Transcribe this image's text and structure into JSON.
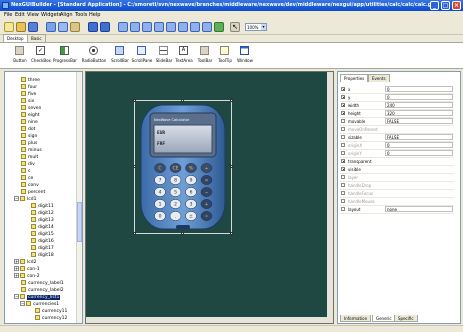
{
  "window": {
    "title": "NexGUIBuilder - [Standard Application] - C:/smoreti/svn/nexwave/branches/middleware/nexwave/dev/middleware/nexgui/app/utilities/calc/calc/calc.gui",
    "minimize": "_",
    "maximize": "□",
    "close": "×"
  },
  "menu": [
    "File",
    "Edit",
    "View",
    "Widgets",
    "Align",
    "Tools",
    "Help"
  ],
  "toolbar": {
    "zoom": "100%",
    "zoom_arrow": "▾"
  },
  "palette_tabs": [
    "Desktop",
    "Basic"
  ],
  "palette": [
    "Button",
    "CheckBox",
    "ProgressBar",
    "RadioButton",
    "ScrollBar",
    "ScrollPane",
    "SlideBar",
    "TextArea",
    "ToolBar",
    "ToolTip",
    "Window"
  ],
  "tree": [
    {
      "label": "three"
    },
    {
      "label": "four"
    },
    {
      "label": "five"
    },
    {
      "label": "six"
    },
    {
      "label": "seven"
    },
    {
      "label": "eight"
    },
    {
      "label": "nine"
    },
    {
      "label": "dot"
    },
    {
      "label": "sign"
    },
    {
      "label": "plus"
    },
    {
      "label": "minus"
    },
    {
      "label": "mult"
    },
    {
      "label": "div"
    },
    {
      "label": "c"
    },
    {
      "label": "ce"
    },
    {
      "label": "conv"
    },
    {
      "label": "percent"
    },
    {
      "label": "lcd1",
      "toggle": "−"
    },
    {
      "label": "digit11"
    },
    {
      "label": "digit12"
    },
    {
      "label": "digit13"
    },
    {
      "label": "digit14"
    },
    {
      "label": "digit15"
    },
    {
      "label": "digit16"
    },
    {
      "label": "digit17"
    },
    {
      "label": "digit18"
    },
    {
      "label": "lcd2",
      "toggle": "+"
    },
    {
      "label": "con-1",
      "toggle": "+"
    },
    {
      "label": "con-2",
      "toggle": "+"
    },
    {
      "label": "currency_label1"
    },
    {
      "label": "currency_label2"
    },
    {
      "label": "currency_list1",
      "toggle": "−",
      "selected": true
    },
    {
      "label": "currencies1",
      "toggle": "−"
    },
    {
      "label": "currency11"
    },
    {
      "label": "currency12"
    }
  ],
  "calculator": {
    "title": "NexWave Calculator",
    "lcd1": "EUR",
    "lcd2": "FRF",
    "keys": [
      [
        "C",
        "CE",
        "%",
        "÷"
      ],
      [
        "7",
        "8",
        "9",
        "×"
      ],
      [
        "4",
        "5",
        "6",
        "−"
      ],
      [
        "1",
        "2",
        "3",
        "+"
      ],
      [
        "0",
        ".",
        "±",
        "="
      ]
    ]
  },
  "props_tabs": [
    "Properties",
    "Events"
  ],
  "props": [
    {
      "name": "x",
      "value": "0",
      "checked": true,
      "enabled": true
    },
    {
      "name": "y",
      "value": "0",
      "checked": true,
      "enabled": true
    },
    {
      "name": "width",
      "value": "240",
      "checked": true,
      "enabled": true
    },
    {
      "name": "height",
      "value": "320",
      "checked": true,
      "enabled": true
    },
    {
      "name": "movable",
      "value": "FALSE",
      "checked": false,
      "enabled": true
    },
    {
      "name": "moveOnParent",
      "value": "",
      "checked": false,
      "enabled": false
    },
    {
      "name": "sizable",
      "value": "FALSE",
      "checked": false,
      "enabled": true
    },
    {
      "name": "originX",
      "value": "0",
      "checked": false,
      "enabled": false
    },
    {
      "name": "originY",
      "value": "0",
      "checked": false,
      "enabled": false
    },
    {
      "name": "transparent",
      "value": "",
      "checked": true,
      "enabled": true
    },
    {
      "name": "visible",
      "value": "",
      "checked": true,
      "enabled": true
    },
    {
      "name": "layer",
      "value": "",
      "checked": false,
      "enabled": false
    },
    {
      "name": "handleDrop",
      "value": "",
      "checked": false,
      "enabled": false
    },
    {
      "name": "handleFocus",
      "value": "",
      "checked": false,
      "enabled": false
    },
    {
      "name": "handleMouse",
      "value": "",
      "checked": false,
      "enabled": false
    },
    {
      "name": "layout",
      "value": "none",
      "checked": false,
      "enabled": true
    }
  ],
  "bottom_tabs": [
    "Information",
    "Generic",
    "Specific"
  ]
}
